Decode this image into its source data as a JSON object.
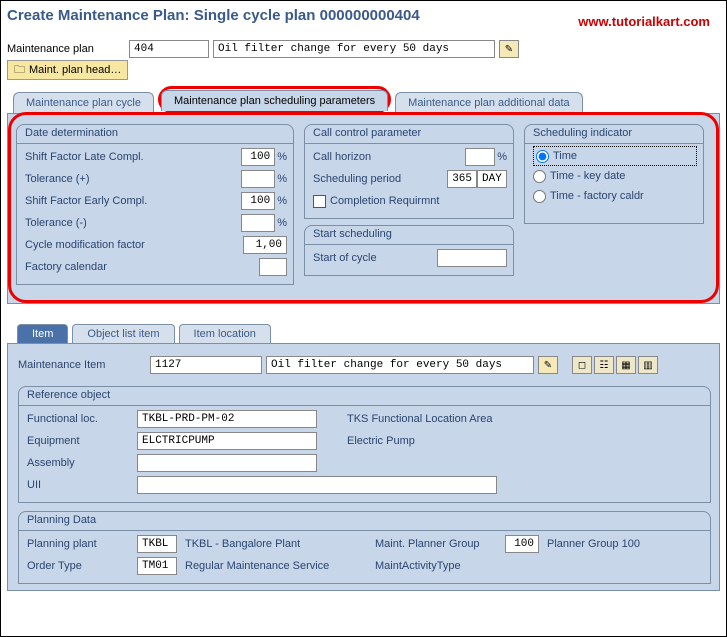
{
  "header": {
    "title": "Create Maintenance Plan: Single cycle plan 000000000404",
    "brand": "www.tutorialkart.com"
  },
  "maint": {
    "plan_label": "Maintenance plan",
    "plan_no": "404",
    "plan_text": "Oil filter change for every 50 days",
    "head_btn": "Maint. plan head…"
  },
  "tabs": {
    "cycle": "Maintenance plan cycle",
    "sched": "Maintenance plan scheduling parameters",
    "addl": "Maintenance plan additional data"
  },
  "date_det": {
    "title": "Date determination",
    "sf_late": "Shift Factor Late Compl.",
    "sf_late_v": "100",
    "tol_plus": "Tolerance (+)",
    "tol_plus_v": "",
    "sf_early": "Shift Factor Early Compl.",
    "sf_early_v": "100",
    "tol_minus": "Tolerance (-)",
    "tol_minus_v": "",
    "cyc_mod": "Cycle modification factor",
    "cyc_mod_v": "1,00",
    "factory_cal": "Factory calendar",
    "factory_cal_v": ""
  },
  "ccp": {
    "title": "Call control parameter",
    "call_horizon": "Call horizon",
    "call_horizon_v": "",
    "sched_period": "Scheduling period",
    "sched_period_v": "365",
    "sched_period_u": "DAY",
    "completion": "Completion Requirmnt"
  },
  "sched_ind": {
    "title": "Scheduling indicator",
    "time": "Time",
    "time_key": "Time - key date",
    "time_fact": "Time - factory caldr"
  },
  "start": {
    "title": "Start scheduling",
    "start_cycle": "Start of cycle",
    "start_cycle_v": ""
  },
  "tabs2": {
    "item": "Item",
    "objlist": "Object list item",
    "itemloc": "Item location"
  },
  "mitem": {
    "label": "Maintenance Item",
    "no": "1127",
    "text": "Oil filter change for every 50 days"
  },
  "refobj": {
    "title": "Reference object",
    "funcloc_l": "Functional loc.",
    "funcloc_v": "TKBL-PRD-PM-02",
    "funcloc_d": "TKS Functional Location Area",
    "equip_l": "Equipment",
    "equip_v": "ELCTRICPUMP",
    "equip_d": "Electric Pump",
    "assembly_l": "Assembly",
    "assembly_v": "",
    "uii_l": "UII",
    "uii_v": ""
  },
  "plandata": {
    "title": "Planning Data",
    "plant_l": "Planning plant",
    "plant_v": "TKBL",
    "plant_d": "TKBL - Bangalore Plant",
    "order_l": "Order Type",
    "order_v": "TM01",
    "order_d": "Regular Maintenance Service",
    "plgrp_l": "Maint. Planner Group",
    "plgrp_v": "100",
    "plgrp_d": "Planner Group 100",
    "acttype_l": "MaintActivityType"
  }
}
